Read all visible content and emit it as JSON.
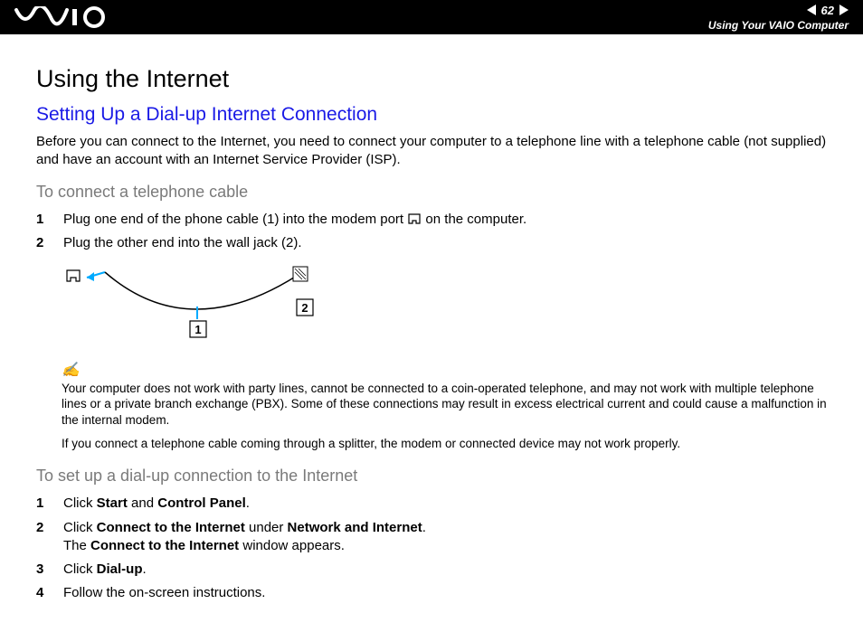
{
  "header": {
    "page_number": "62",
    "section": "Using Your VAIO Computer"
  },
  "title": "Using the Internet",
  "subtitle": "Setting Up a Dial-up Internet Connection",
  "intro": "Before you can connect to the Internet, you need to connect your computer to a telephone line with a telephone cable (not supplied) and have an account with an Internet Service Provider (ISP).",
  "section_a": {
    "heading": "To connect a telephone cable",
    "steps": [
      {
        "n": "1",
        "text_before": "Plug one end of the phone cable (1) into the modem port ",
        "text_after": " on the computer."
      },
      {
        "n": "2",
        "text": "Plug the other end into the wall jack (2)."
      }
    ]
  },
  "figure": {
    "label1": "1",
    "label2": "2"
  },
  "note1": "Your computer does not work with party lines, cannot be connected to a coin-operated telephone, and may not work with multiple telephone lines or a private branch exchange (PBX). Some of these connections may result in excess electrical current and could cause a malfunction in the internal modem.",
  "note2": "If you connect a telephone cable coming through a splitter, the modem or connected device may not work properly.",
  "section_b": {
    "heading": "To set up a dial-up connection to the Internet",
    "steps": [
      {
        "n": "1",
        "html": "Click <strong>Start</strong> and <strong>Control Panel</strong>."
      },
      {
        "n": "2",
        "html": "Click <strong>Connect to the Internet</strong> under <strong>Network and Internet</strong>.<br>The <strong>Connect to the Internet</strong> window appears."
      },
      {
        "n": "3",
        "html": "Click <strong>Dial-up</strong>."
      },
      {
        "n": "4",
        "html": "Follow the on-screen instructions."
      }
    ]
  }
}
